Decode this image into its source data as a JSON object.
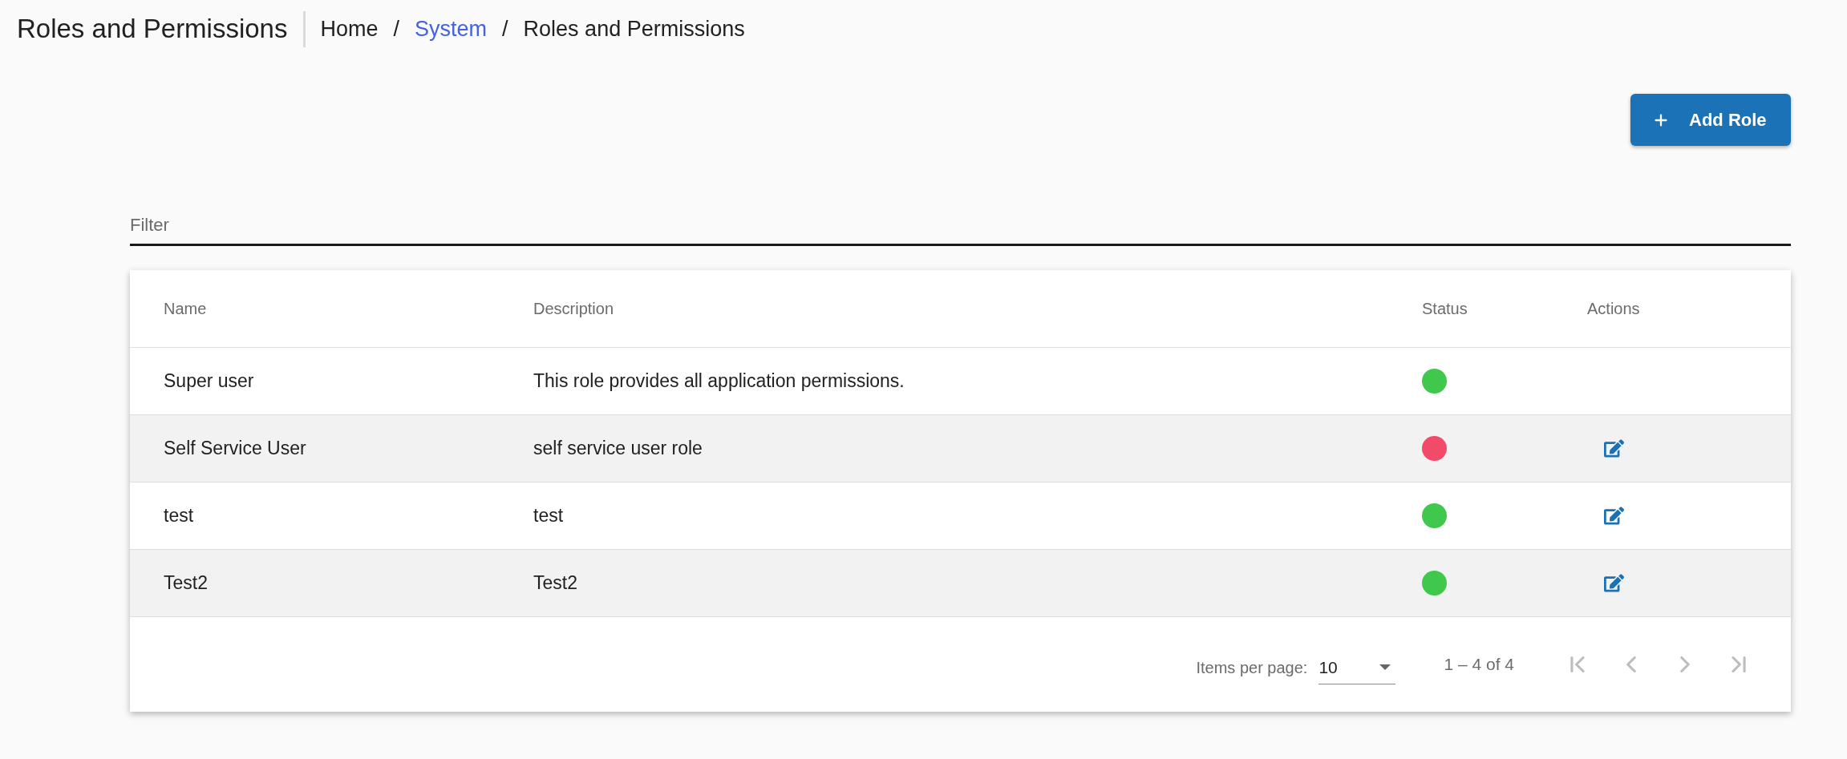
{
  "header": {
    "title": "Roles and Permissions",
    "breadcrumb": [
      {
        "kind": "crumb",
        "label": "Home"
      },
      {
        "kind": "separator",
        "label": "/"
      },
      {
        "kind": "link",
        "label": "System"
      },
      {
        "kind": "separator",
        "label": "/"
      },
      {
        "kind": "crumb",
        "label": "Roles and Permissions"
      }
    ]
  },
  "add_button": {
    "label": "Add Role"
  },
  "filter": {
    "placeholder": "Filter"
  },
  "table": {
    "columns": [
      "Name",
      "Description",
      "Status",
      "Actions"
    ],
    "rows": [
      {
        "name": "Super user",
        "description": "This role provides all application permissions.",
        "status": {
          "color": "#40c84c"
        },
        "editable": false
      },
      {
        "name": "Self Service User",
        "description": "self service user role",
        "status": {
          "color": "#f14b69"
        },
        "editable": true
      },
      {
        "name": "test",
        "description": "test",
        "status": {
          "color": "#40c84c"
        },
        "editable": true
      },
      {
        "name": "Test2",
        "description": "Test2",
        "status": {
          "color": "#40c84c"
        },
        "editable": true
      }
    ]
  },
  "pagination": {
    "items_per_page_label": "Items per page:",
    "page_size": "10",
    "range": "1 – 4 of 4",
    "buttons": [
      {
        "kind": "first",
        "disabled": true
      },
      {
        "kind": "previous",
        "disabled": true
      },
      {
        "kind": "next",
        "disabled": true
      },
      {
        "kind": "last",
        "disabled": true
      }
    ]
  }
}
